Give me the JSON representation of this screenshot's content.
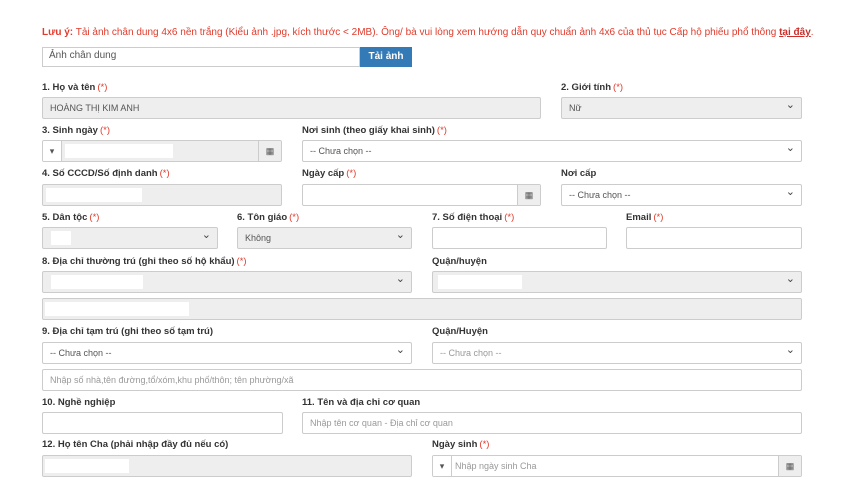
{
  "notice": {
    "prefix": "Lưu ý:",
    "text": " Tải ảnh chân dung 4x6 nền trắng (Kiểu ảnh .jpg, kích thước < 2MB). Ông/ bà vui lòng xem hướng dẫn quy chuẩn ảnh 4x6 của thủ tục Cấp hộ phiếu phổ thông ",
    "link": "tại đây",
    "suffix": "."
  },
  "photo": {
    "placeholder": "Ảnh chân dung",
    "button": "Tải ảnh"
  },
  "required_mark": "(*)",
  "fields": {
    "full_name": {
      "label": "1. Họ và tên",
      "value": "HOÀNG THỊ KIM ANH"
    },
    "gender": {
      "label": "2. Giới tính",
      "value": "Nữ"
    },
    "birth_date": {
      "label": "3. Sinh ngày",
      "stepper": "▾"
    },
    "birth_place": {
      "label": "Nơi sinh (theo giấy khai sinh)",
      "value": "-- Chưa chọn --"
    },
    "id_number": {
      "label": "4. Số CCCD/Số định danh"
    },
    "issue_date": {
      "label": "Ngày cấp"
    },
    "issue_place": {
      "label": "Nơi cấp",
      "value": "-- Chưa chọn --"
    },
    "ethnicity": {
      "label": "5. Dân tộc"
    },
    "religion": {
      "label": "6. Tôn giáo",
      "value": "Không"
    },
    "phone": {
      "label": "7. Số điện thoại"
    },
    "email": {
      "label": "Email"
    },
    "permanent_address": {
      "label": "8. Địa chỉ thường trú (ghi theo số hộ khẩu)"
    },
    "permanent_district": {
      "label": "Quận/huyện"
    },
    "temp_address": {
      "label": "9. Địa chỉ tạm trú (ghi theo số tạm trú)",
      "value": "-- Chưa chọn --"
    },
    "temp_district": {
      "label": "Quận/Huyện",
      "value": "-- Chưa chọn --"
    },
    "temp_street": {
      "placeholder": "Nhập số nhà,tên đường,tổ/xóm,khu phố/thôn; tên phường/xã"
    },
    "occupation": {
      "label": "10. Nghề nghiệp"
    },
    "workplace": {
      "label": "11. Tên và địa chỉ cơ quan",
      "placeholder": "Nhập tên cơ quan - Địa chỉ cơ quan"
    },
    "father_name": {
      "label": "12. Họ tên Cha (phải nhập đầy đủ nếu có)"
    },
    "father_dob": {
      "label": "Ngày sinh",
      "placeholder": "Nhập ngày sinh Cha",
      "stepper": "▾"
    }
  },
  "icons": {
    "calendar": "calendar-icon",
    "chevron": "chevron-down-icon"
  }
}
